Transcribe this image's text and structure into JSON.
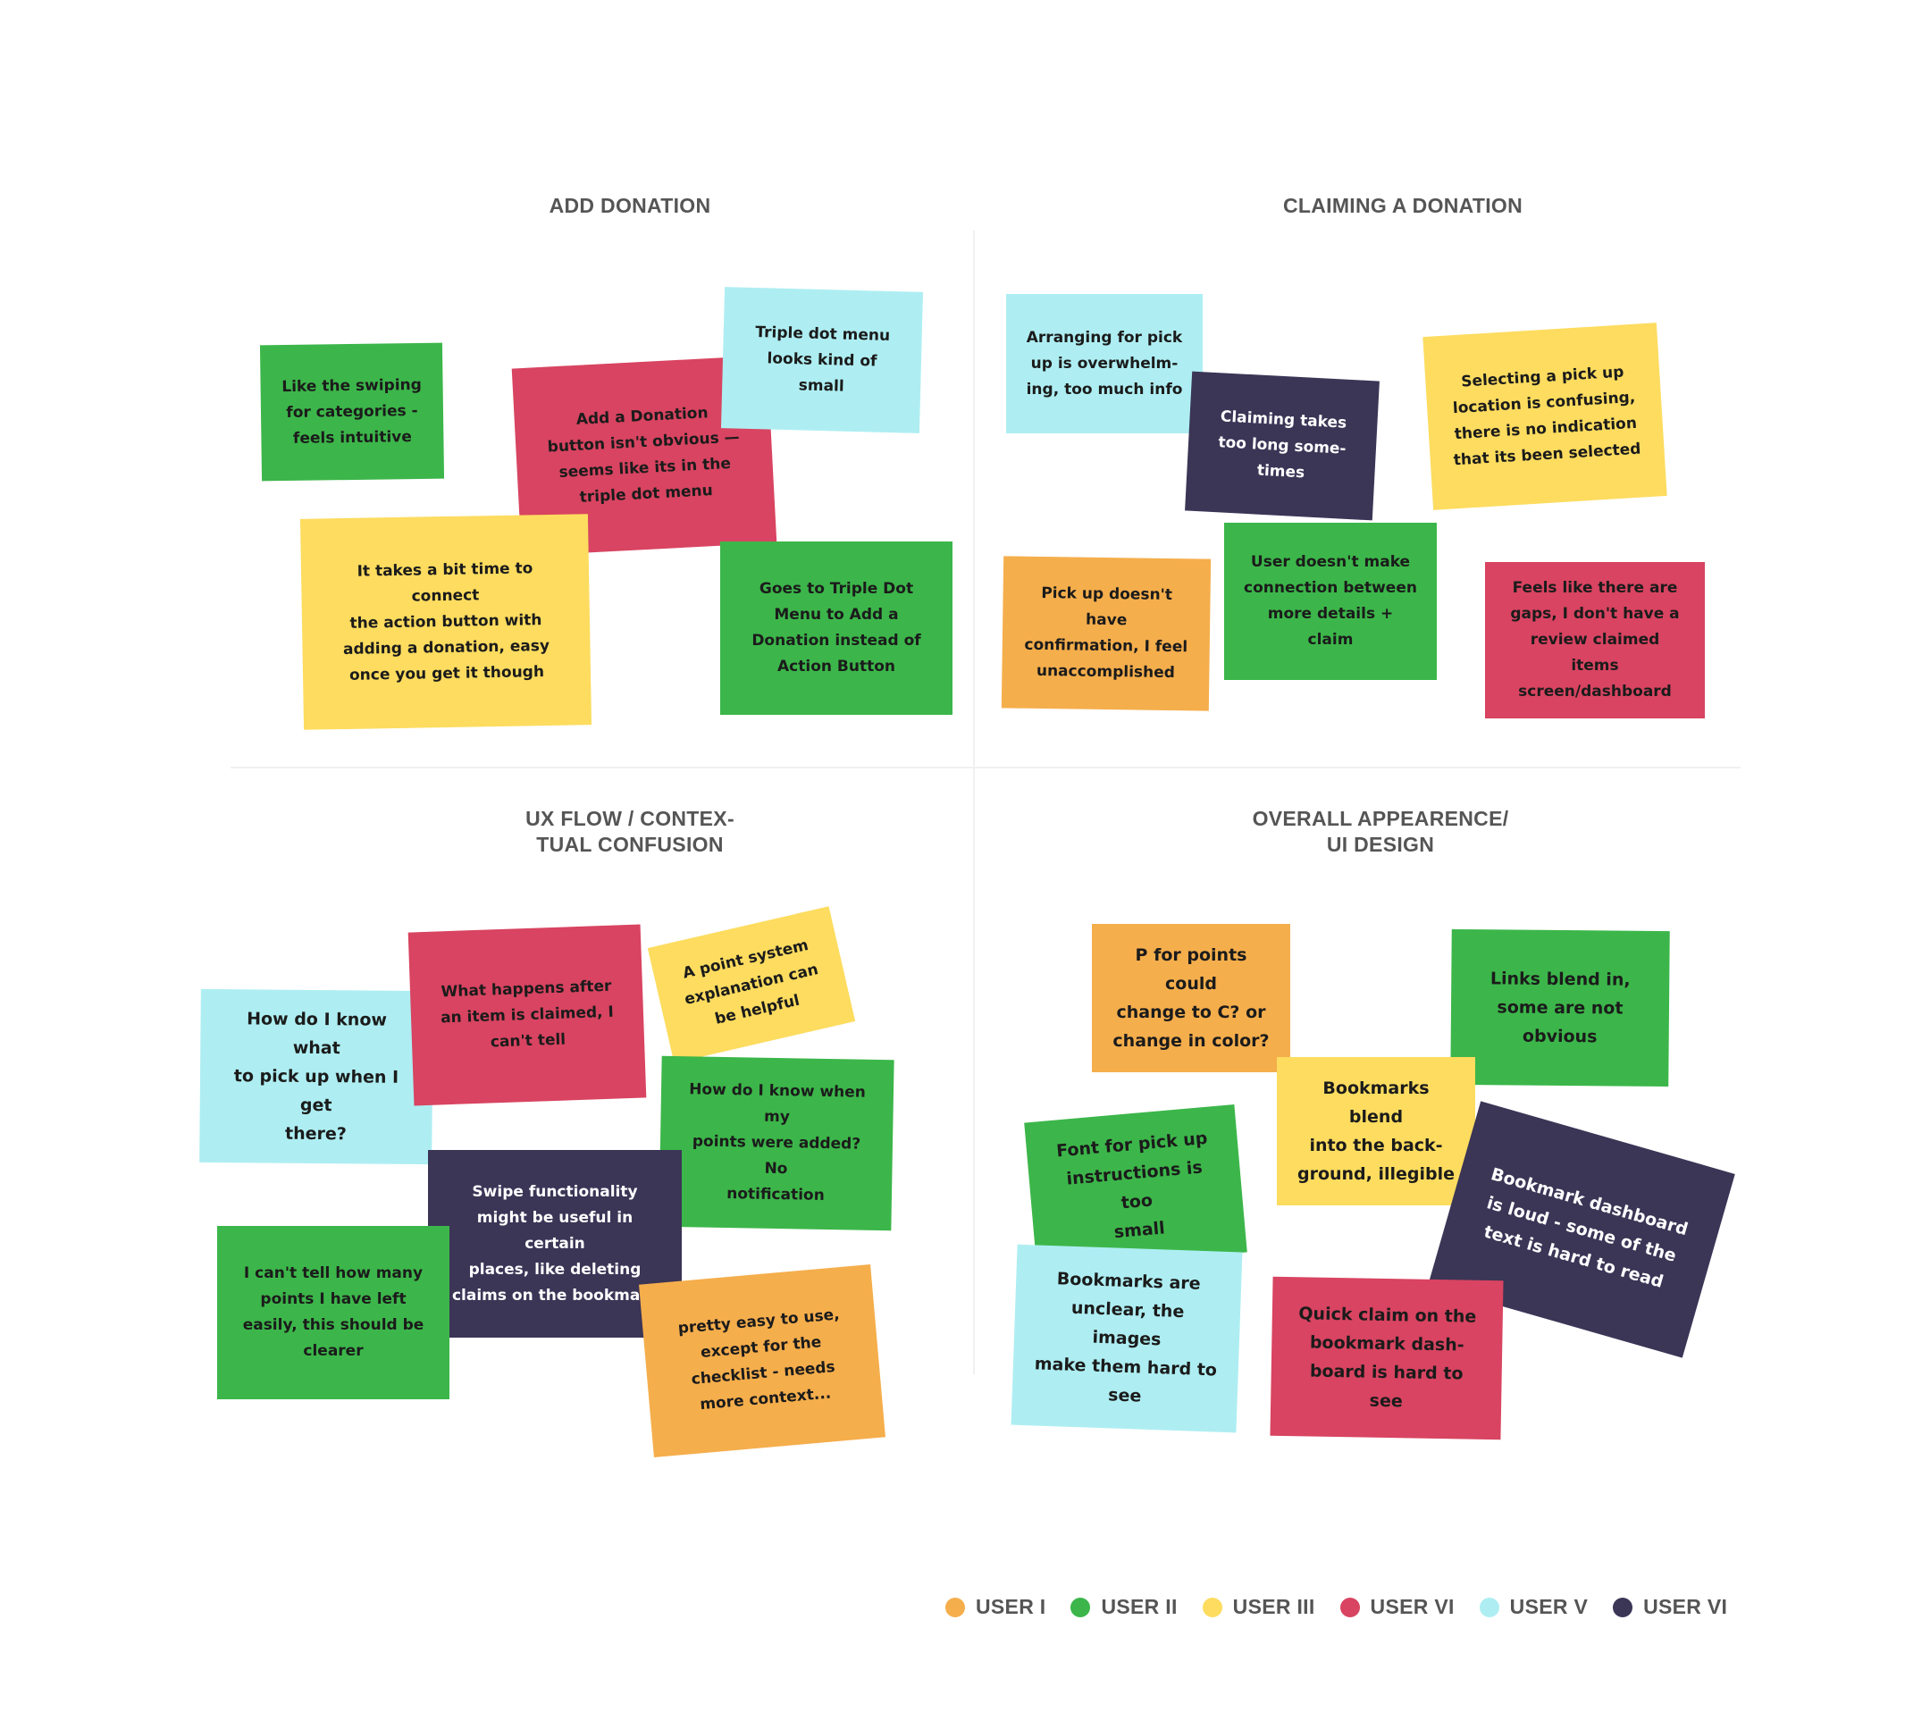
{
  "colors": {
    "orange": "#F5AE4C",
    "green": "#3CB64A",
    "yellow": "#FDDC5F",
    "red": "#D84461",
    "cyan": "#AEEEF2",
    "navy": "#3B3556",
    "title": "#555555"
  },
  "quadrants": [
    {
      "title": "ADD DONATION"
    },
    {
      "title": "CLAIMING A DONATION"
    },
    {
      "title": "UX FLOW / CONTEX-\nTUAL CONFUSION"
    },
    {
      "title": "OVERALL APPEARENCE/\nUI DESIGN"
    }
  ],
  "notes": {
    "n1": "Like the swiping\nfor categories -\nfeels intuitive",
    "n2": "Add a Donation\nbutton isn't obvious —\nseems like its in the\ntriple dot menu",
    "n3": "Triple dot menu\nlooks kind of small",
    "n4": "It takes a bit time to connect\nthe action button with\nadding a donation, easy\nonce you get it though",
    "n5": "Goes to Triple Dot\nMenu to Add a\nDonation instead of\nAction Button",
    "n6": "Arranging for pick\nup is overwhelm-\ning, too much info",
    "n7": "Claiming takes\ntoo long some-\ntimes",
    "n8": "Selecting a pick up\nlocation is confusing,\nthere is no indication\nthat its been selected",
    "n9": "Pick up doesn't have\nconfirmation, I feel\nunaccomplished",
    "n10a": "User doesn't make\nconnection between\n",
    "n10b": "more details + claim",
    "n11": "Feels like there are\ngaps,  I don't have a\nreview claimed items\nscreen/dashboard",
    "n12": "What happens after\nan item is claimed, I\ncan't tell",
    "n13": "A point system\nexplanation can\nbe helpful",
    "n14": "How do I know what\nto pick up when I get\nthere?",
    "n15": "How do I know when my\npoints were added? No\nnotification",
    "n16": "Swipe functionality\nmight be useful in certain\nplaces, like deleting\nclaims on the bookmark",
    "n17": "I can't tell how many\npoints I have left\neasily, this should be\nclearer",
    "n18": "pretty easy to use,\nexcept for the\nchecklist - needs\nmore context...",
    "n19": "P for points could\nchange to C? or\nchange in color?",
    "n20": "Links blend in,\nsome are not\nobvious",
    "n21": "Bookmarks blend\ninto the back-\nground, illegible",
    "n22": "Font for pick up\ninstructions is too\nsmall",
    "n23": "Bookmark dashboard\nis loud - some of the\ntext is hard to read",
    "n24": "Bookmarks are\nunclear, the images\nmake them hard to\nsee",
    "n25": "Quick claim on the\nbookmark dash-\nboard is hard to see"
  },
  "legend": [
    {
      "label": "USER I",
      "color": "#F5AE4C"
    },
    {
      "label": "USER II",
      "color": "#3CB64A"
    },
    {
      "label": "USER III",
      "color": "#FDDC5F"
    },
    {
      "label": "USER VI",
      "color": "#D84461"
    },
    {
      "label": "USER V",
      "color": "#AEEEF2"
    },
    {
      "label": "USER VI",
      "color": "#3B3556"
    }
  ]
}
